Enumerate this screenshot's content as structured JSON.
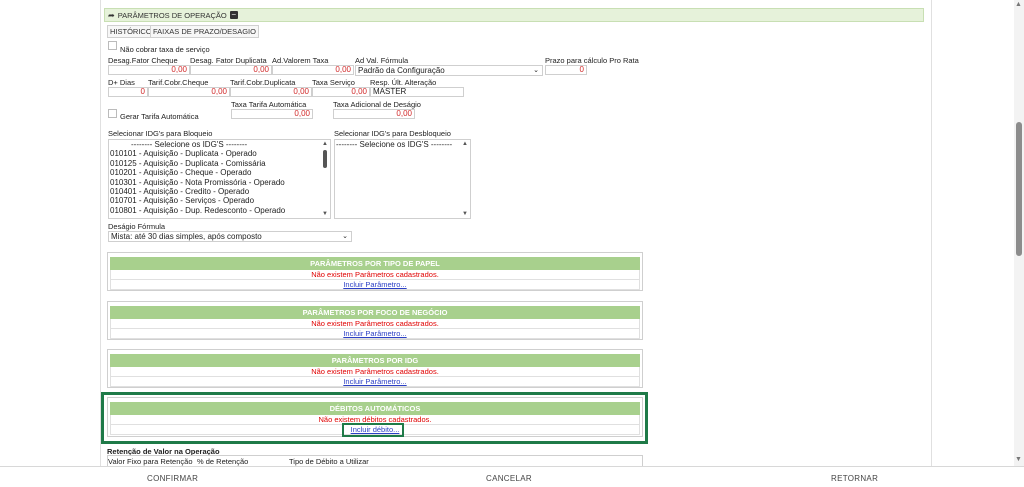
{
  "section": {
    "title": "PARÂMETROS DE OPERAÇÃO",
    "toggle_symbol": "−"
  },
  "tabs": [
    "HISTÓRICO",
    "FAIXAS DE PRAZO/DESAGIO"
  ],
  "nao_cobrar": {
    "label": "Não cobrar taxa de serviço"
  },
  "row1": {
    "desag_fator_cheque": {
      "label": "Desag.Fator Cheque",
      "value": "0,00"
    },
    "desag_fator_duplicata": {
      "label": "Desag. Fator Duplicata",
      "value": "0,00"
    },
    "ad_valorem_taxa": {
      "label": "Ad.Valorem Taxa",
      "value": "0,00"
    },
    "ad_val_formula": {
      "label": "Ad Val. Fórmula",
      "value": "Padrão da Configuração"
    },
    "prazo_pro_rata": {
      "label": "Prazo para cálculo Pro Rata",
      "value": "0"
    }
  },
  "row2": {
    "d_dias": {
      "label": "D+ Dias",
      "value": "0"
    },
    "tarif_cheque": {
      "label": "Tarif.Cobr.Cheque",
      "value": "0,00"
    },
    "tarif_duplicata": {
      "label": "Tarif.Cobr.Duplicata",
      "value": "0,00"
    },
    "taxa_servico": {
      "label": "Taxa Serviço",
      "value": "0,00"
    },
    "resp_ult_alteracao": {
      "label": "Resp. Últ. Alteração",
      "value": "MASTER"
    }
  },
  "row3": {
    "gerar_tarifa": {
      "label": "Gerar Tarifa Automática"
    },
    "taxa_tarifa_auto": {
      "label": "Taxa Tarifa Automática",
      "value": "0,00"
    },
    "taxa_adicional_desagio": {
      "label": "Taxa Adicional de Deságio",
      "value": "0,00"
    }
  },
  "idg_bloqueio": {
    "label": "Selecionar IDG's para Bloqueio",
    "options": [
      "-------- Selecione os IDG'S --------",
      "010101 - Aquisição - Duplicata - Operado",
      "010125 - Aquisição - Duplicata - Comissária",
      "010201 - Aquisição - Cheque - Operado",
      "010301 - Aquisição - Nota Promissória - Operado",
      "010401 - Aquisição - Credito - Operado",
      "010701 - Aquisição - Serviços - Operado",
      "010801 - Aquisição - Dup. Redesconto - Operado"
    ]
  },
  "idg_desbloqueio": {
    "label": "Selecionar IDG's para Desbloqueio",
    "options": [
      "-------- Selecione os IDG'S --------"
    ]
  },
  "desagio_formula": {
    "label": "Deságio Fórmula",
    "value": "Mista: até 30 dias simples, após composto"
  },
  "grids": [
    {
      "title": "PARÂMETROS POR TIPO DE PAPEL",
      "empty": "Não existem Parâmetros cadastrados.",
      "link": "Incluir Parâmetro..."
    },
    {
      "title": "PARÂMETROS POR FOCO DE NEGÓCIO",
      "empty": "Não existem Parâmetros cadastrados.",
      "link": "Incluir Parâmetro..."
    },
    {
      "title": "PARÂMETROS POR IDG",
      "empty": "Não existem Parâmetros cadastrados.",
      "link": "Incluir Parâmetro..."
    },
    {
      "title": "DÉBITOS AUTOMÁTICOS",
      "empty": "Não existem débitos cadastrados.",
      "link": "Incluir débito..."
    }
  ],
  "retencao": {
    "title": "Retenção de Valor na Operação",
    "valor_fixo": "Valor Fixo para Retenção",
    "percent": "% de Retenção",
    "tipo_debito": "Tipo de Débito a Utilizar"
  },
  "footer": {
    "confirmar": "CONFIRMAR",
    "cancelar": "CANCELAR",
    "retornar": "RETORNAR"
  },
  "colors": {
    "accent_green": "#a8d08d",
    "highlight": "#1f7a48",
    "error_red": "#e00000",
    "link_blue": "#2b3fc5"
  }
}
